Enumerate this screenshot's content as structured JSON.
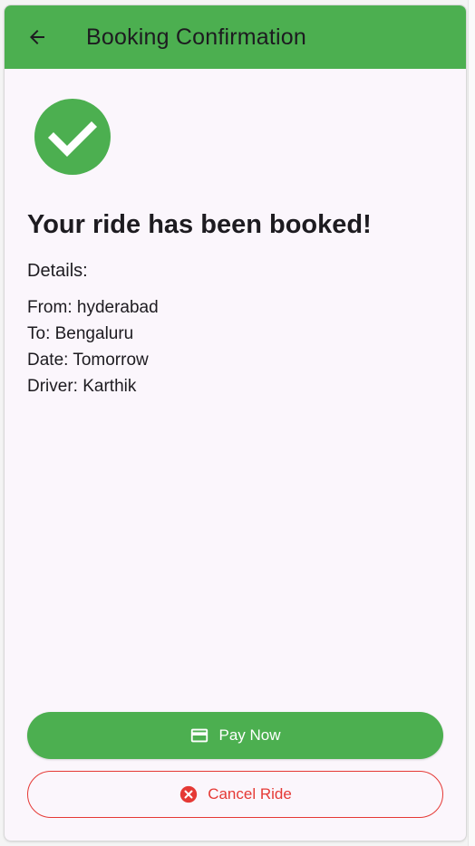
{
  "appbar": {
    "title": "Booking Confirmation",
    "back_icon": "arrow-back-icon",
    "color": "#4caf50"
  },
  "status": {
    "icon": "check-circle-icon",
    "icon_color": "#4caf50",
    "headline": "Your ride has been booked!"
  },
  "details": {
    "label": "Details:",
    "from": "From: hyderabad",
    "to": "To: Bengaluru",
    "date": "Date: Tomorrow",
    "driver": "Driver: Karthik"
  },
  "actions": {
    "pay_label": "Pay Now",
    "pay_icon": "credit-card-icon",
    "pay_color": "#4caf50",
    "cancel_label": "Cancel Ride",
    "cancel_icon": "cancel-icon",
    "cancel_color": "#e53935"
  }
}
